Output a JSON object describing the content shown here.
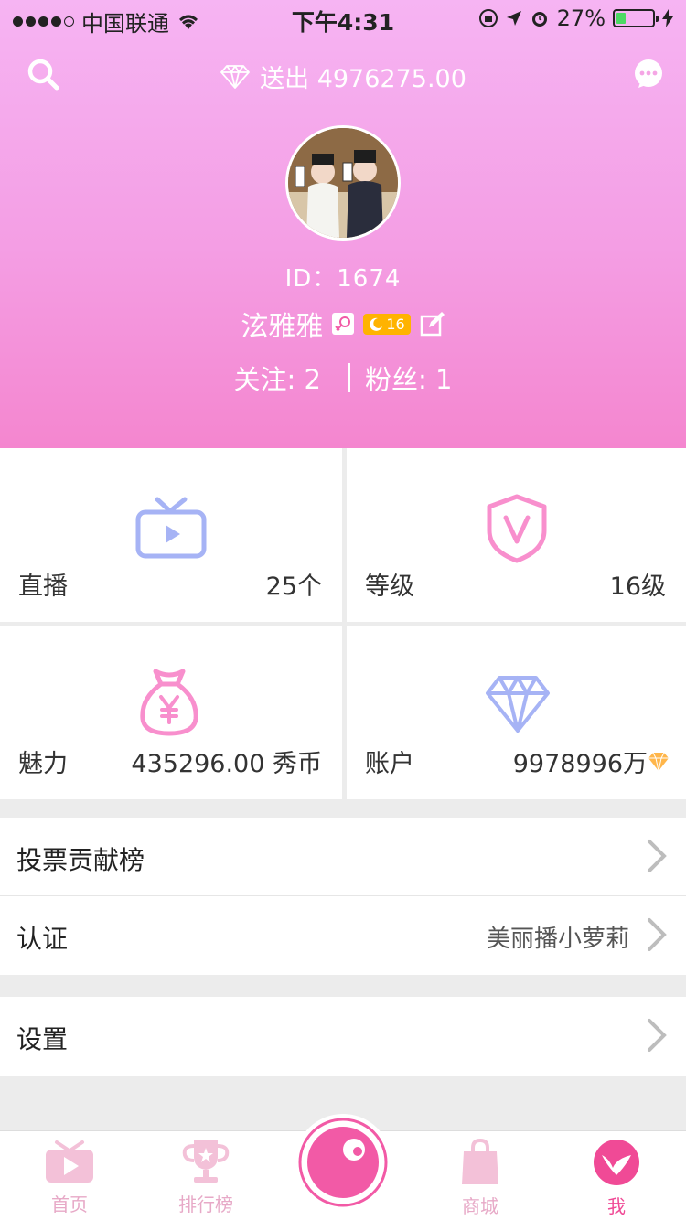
{
  "status_bar": {
    "carrier": "中国联通",
    "time": "下午4:31",
    "battery": "27%",
    "battery_level": 0.27
  },
  "header": {
    "sent_label": "送出 4976275.00",
    "id_text": "ID：1674",
    "username": "泫雅雅",
    "level": "16",
    "follow_label": "关注: 2",
    "fans_label": "粉丝: 1"
  },
  "stats": [
    {
      "label": "直播",
      "value": "25个",
      "icon": "tv-icon"
    },
    {
      "label": "等级",
      "value": "16级",
      "icon": "shield-v-icon"
    },
    {
      "label": "魅力",
      "value": "435296.00 秀币",
      "icon": "money-bag-icon"
    },
    {
      "label": "账户",
      "value": "9978996万",
      "icon": "diamond-icon"
    }
  ],
  "list": {
    "vote": "投票贡献榜",
    "cert_label": "认证",
    "cert_value": "美丽播小萝莉",
    "settings": "设置"
  },
  "tabs": [
    {
      "label": "首页",
      "icon": "play-tv-icon"
    },
    {
      "label": "排行榜",
      "icon": "trophy-icon"
    },
    {
      "label": "商城",
      "icon": "shopping-bag-icon"
    },
    {
      "label": "我",
      "icon": "heart-bird-icon",
      "active": true
    }
  ],
  "colors": {
    "header_top": "#f6b4f3",
    "header_bottom": "#f486cf",
    "accent_pink": "#f25aa6",
    "icon_blue": "#a6b3f5",
    "icon_pink": "#f88fcd"
  }
}
